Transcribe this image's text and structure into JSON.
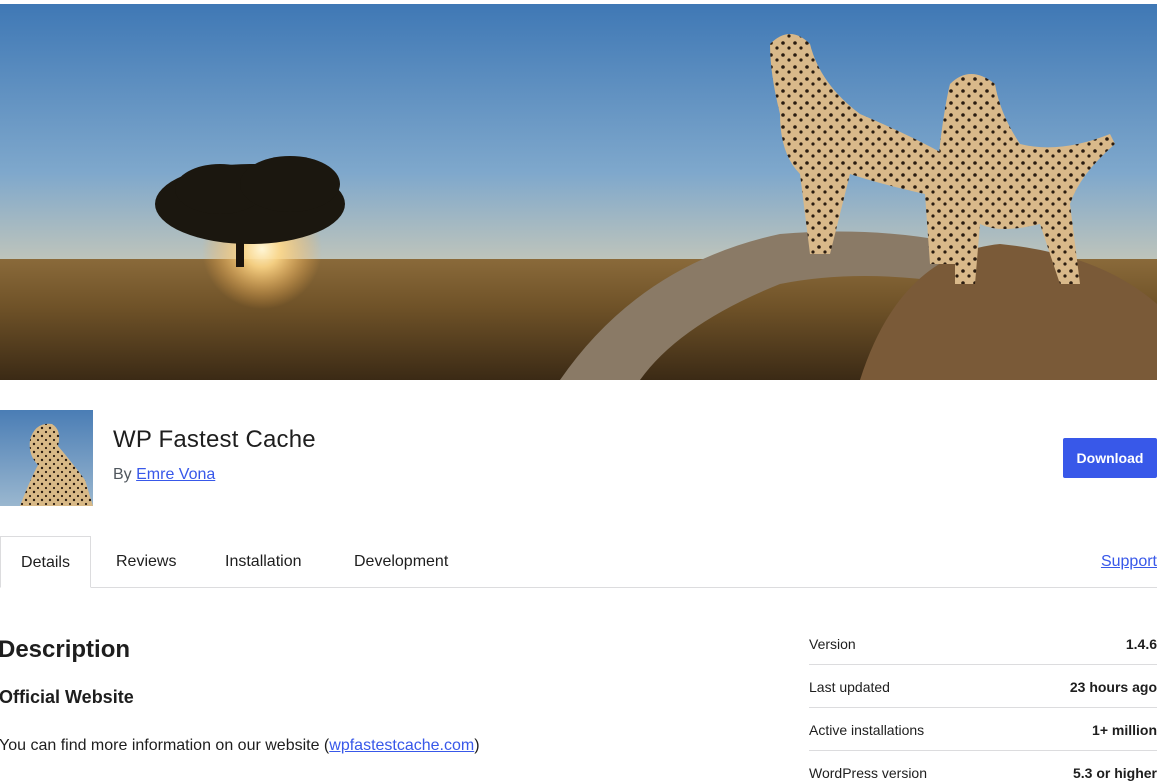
{
  "plugin": {
    "name": "WP Fastest Cache",
    "by_prefix": "By",
    "author": "Emre Vona",
    "download_label": "Download"
  },
  "tabs": [
    {
      "label": "Details",
      "active": true
    },
    {
      "label": "Reviews",
      "active": false
    },
    {
      "label": "Installation",
      "active": false
    },
    {
      "label": "Development",
      "active": false
    }
  ],
  "support_label": "Support",
  "description": {
    "heading": "Description",
    "subheading": "Official Website",
    "text_prefix": "You can find more information on our website (",
    "link_text": "wpfastestcache.com",
    "text_suffix": ")"
  },
  "meta": [
    {
      "label": "Version",
      "value": "1.4.6"
    },
    {
      "label": "Last updated",
      "value": "23 hours ago"
    },
    {
      "label": "Active installations",
      "value": "1+ million"
    },
    {
      "label": "WordPress version",
      "value": "5.3 or higher"
    }
  ],
  "colors": {
    "accent": "#3858e9",
    "border": "#dcdcde",
    "text": "#1e1e1e"
  }
}
